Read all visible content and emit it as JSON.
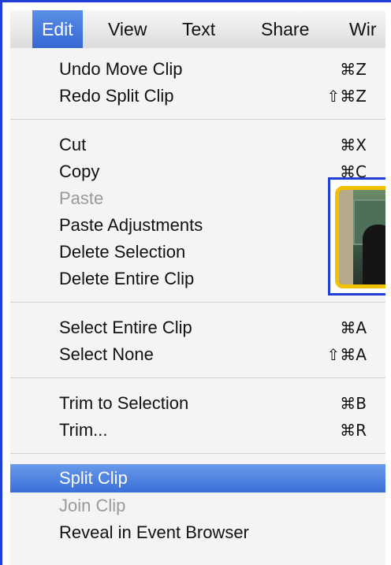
{
  "menubar": {
    "items": [
      "Edit",
      "View",
      "Text",
      "Share",
      "Wir"
    ]
  },
  "menu": {
    "groups": [
      [
        {
          "label": "Undo Move Clip",
          "shortcut": "⌘Z",
          "enabled": true
        },
        {
          "label": "Redo Split Clip",
          "shortcut": "⇧⌘Z",
          "enabled": true
        }
      ],
      [
        {
          "label": "Cut",
          "shortcut": "⌘X",
          "enabled": true
        },
        {
          "label": "Copy",
          "shortcut": "⌘C",
          "enabled": true
        },
        {
          "label": "Paste",
          "shortcut": "",
          "enabled": false
        },
        {
          "label": "Paste Adjustments",
          "shortcut": "",
          "enabled": true
        },
        {
          "label": "Delete Selection",
          "shortcut": "",
          "enabled": true
        },
        {
          "label": "Delete Entire Clip",
          "shortcut": "",
          "enabled": true
        }
      ],
      [
        {
          "label": "Select Entire Clip",
          "shortcut": "⌘A",
          "enabled": true
        },
        {
          "label": "Select None",
          "shortcut": "⇧⌘A",
          "enabled": true
        }
      ],
      [
        {
          "label": "Trim to Selection",
          "shortcut": "⌘B",
          "enabled": true
        },
        {
          "label": "Trim...",
          "shortcut": "⌘R",
          "enabled": true
        }
      ],
      [
        {
          "label": "Split Clip",
          "shortcut": "",
          "enabled": true,
          "highlighted": true
        },
        {
          "label": "Join Clip",
          "shortcut": "",
          "enabled": false
        },
        {
          "label": "Reveal in Event Browser",
          "shortcut": "",
          "enabled": true
        }
      ]
    ]
  },
  "colors": {
    "highlight": "#3a6fd8",
    "annotation_border": "#1f3fd6",
    "thumbnail_border": "#f2c200",
    "disabled_text": "#9a9a9a"
  }
}
